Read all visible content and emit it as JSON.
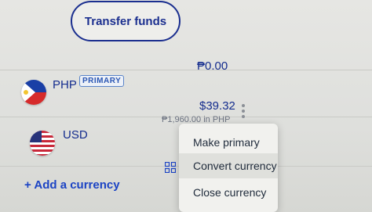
{
  "header": {
    "transfer_label": "Transfer funds"
  },
  "currencies": [
    {
      "code": "PHP",
      "badge": "PRIMARY",
      "amount": "₱0.00",
      "sub_amount": ""
    },
    {
      "code": "USD",
      "badge": "",
      "amount": "$39.32",
      "sub_amount": "₱1,960.00 in PHP"
    }
  ],
  "actions": {
    "add_currency": "+ Add a currency",
    "convert_peek": "C"
  },
  "menu": {
    "items": [
      "Make primary",
      "Convert currency",
      "Close currency"
    ],
    "highlighted_index": 1
  },
  "colors": {
    "brand": "#142c8e",
    "link": "#1b43c4"
  },
  "icons": {
    "php_flag": "philippines-flag-icon",
    "usd_flag": "us-flag-icon",
    "more": "kebab-menu-icon",
    "convert": "convert-grid-icon"
  }
}
